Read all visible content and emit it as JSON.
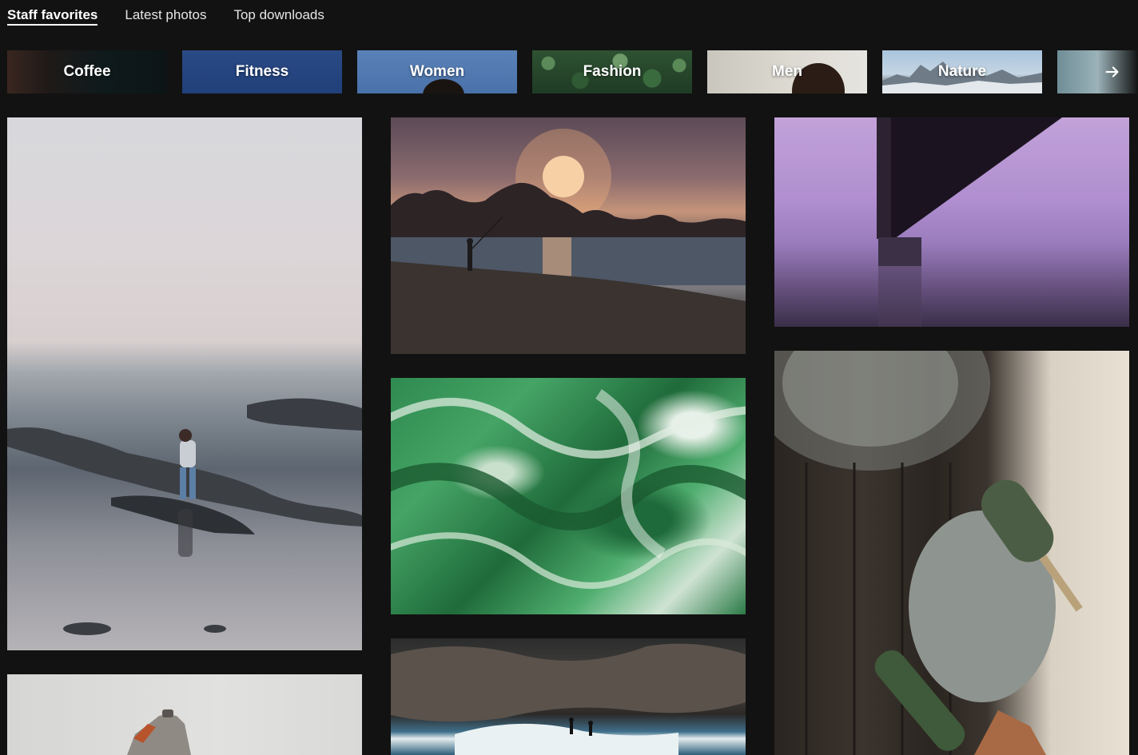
{
  "tabs": [
    {
      "label": "Staff favorites",
      "active": true
    },
    {
      "label": "Latest photos",
      "active": false
    },
    {
      "label": "Top downloads",
      "active": false
    }
  ],
  "categories": [
    {
      "label": "Coffee"
    },
    {
      "label": "Fitness"
    },
    {
      "label": "Women"
    },
    {
      "label": "Fashion"
    },
    {
      "label": "Men"
    },
    {
      "label": "Nature"
    }
  ],
  "category_scroll": {
    "icon": "arrow-right-icon"
  },
  "photos": [
    {
      "icon": "photo-woman-tidepool"
    },
    {
      "icon": "photo-studio-lamp"
    },
    {
      "icon": "photo-beach-sunset-fisherman"
    },
    {
      "icon": "photo-green-swirl"
    },
    {
      "icon": "photo-surfers-wave"
    },
    {
      "icon": "photo-bridge-purple-fog"
    },
    {
      "icon": "photo-jade-roller"
    }
  ],
  "colors": {
    "background": "#121212",
    "text": "#ffffff",
    "tab_inactive": "#e6e6e6"
  }
}
